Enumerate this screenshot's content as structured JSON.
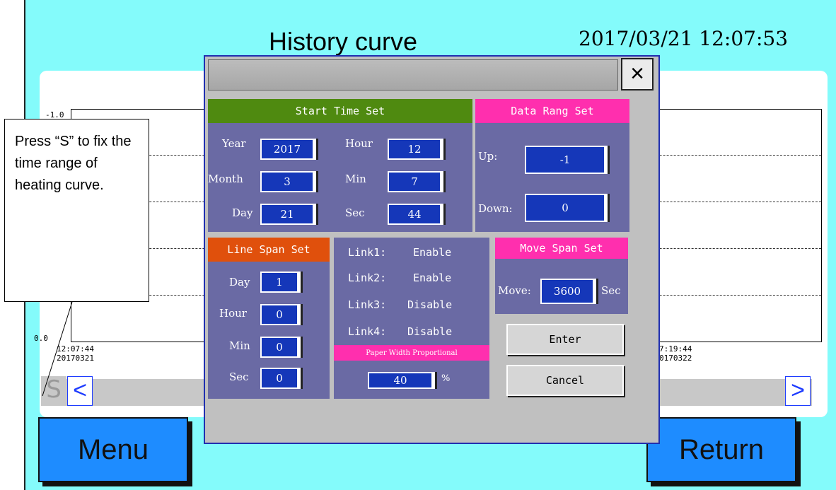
{
  "screen": {
    "title": "History curve",
    "datetime": "2017/03/21 12:07:53"
  },
  "chart": {
    "y_top": "-1.0",
    "y_bottom": "0.0",
    "x_start_time": "12:07:44",
    "x_start_date": "20170321",
    "x_end_time": "7:19:44",
    "x_end_date": "0170322"
  },
  "scroll": {
    "s_label": "S",
    "prev": "<",
    "next": ">"
  },
  "buttons": {
    "menu": "Menu",
    "return": "Return"
  },
  "callout": {
    "text": "Press “S” to fix the time range of heating curve."
  },
  "dialog": {
    "close": "×",
    "start_time": {
      "header": "Start Time Set",
      "year_label": "Year",
      "year": "2017",
      "month_label": "Month",
      "month": "3",
      "day_label": "Day",
      "day": "21",
      "hour_label": "Hour",
      "hour": "12",
      "min_label": "Min",
      "min": "7",
      "sec_label": "Sec",
      "sec": "44"
    },
    "data_range": {
      "header": "Data Rang Set",
      "up_label": "Up:",
      "up": "-1",
      "down_label": "Down:",
      "down": "0"
    },
    "line_span": {
      "header": "Line Span Set",
      "day_label": "Day",
      "day": "1",
      "hour_label": "Hour",
      "hour": "0",
      "min_label": "Min",
      "min": "0",
      "sec_label": "Sec",
      "sec": "0"
    },
    "links": [
      {
        "name": "Link1:",
        "state": "Enable"
      },
      {
        "name": "Link2:",
        "state": "Enable"
      },
      {
        "name": "Link3:",
        "state": "Disable"
      },
      {
        "name": "Link4:",
        "state": "Disable"
      }
    ],
    "paper_width": {
      "header": "Paper Width Proportional",
      "value": "40",
      "unit": "%"
    },
    "move_span": {
      "header": "Move Span Set",
      "move_label": "Move:",
      "value": "3600",
      "unit": "Sec"
    },
    "enter": "Enter",
    "cancel": "Cancel"
  },
  "colors": {
    "screen_bg": "#84fbfb",
    "start_time_header": "#4f8a10",
    "data_range_header": "#ff2fae",
    "line_span_header": "#e0500c",
    "panel": "#6a6aa4",
    "field": "#1537b9",
    "big_button": "#1e8cff"
  }
}
